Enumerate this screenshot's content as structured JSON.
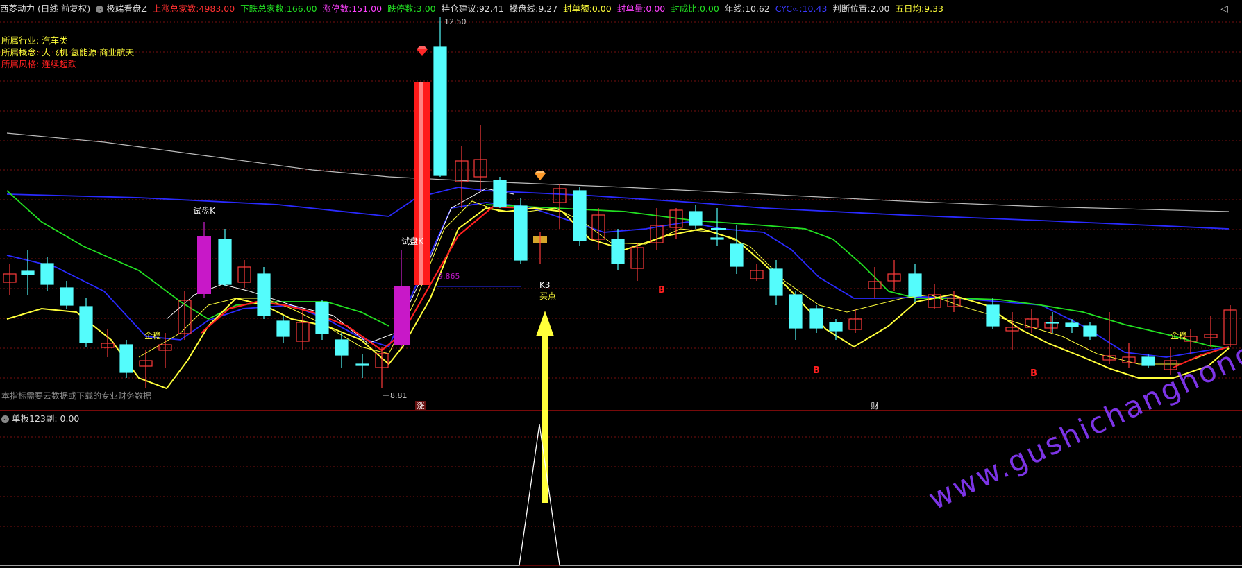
{
  "header": {
    "title": "西菱动力 (日线 前复权)",
    "indicator_name": "极端看盘Z",
    "up_total_label": "上涨总家数:",
    "up_total_value": "4983.00",
    "down_total_label": "下跌总家数:",
    "down_total_value": "166.00",
    "limit_up_label": "涨停数:",
    "limit_up_value": "151.00",
    "limit_down_label": "跌停数:",
    "limit_down_value": "3.00",
    "position_label": "持仓建议:",
    "position_value": "92.41",
    "operate_label": "操盘线:",
    "operate_value": "9.27",
    "seal_amount_label": "封单额:",
    "seal_amount_value": "0.00",
    "seal_volume_label": "封单量:",
    "seal_volume_value": "0.00",
    "seal_ratio_label": "封成比:",
    "seal_ratio_value": "0.00",
    "year_line_label": "年线:",
    "year_line_value": "10.62",
    "cyc_label": "CYC∞:",
    "cyc_value": "10.43",
    "judge_label": "判断位置:",
    "judge_value": "2.00",
    "five_day_label": "五日均:",
    "five_day_value": "9.33",
    "close_icon": "chevron-left-icon"
  },
  "info": {
    "industry_label": "所属行业:",
    "industry_value": "汽车类",
    "concept_label": "所属概念:",
    "concept_value": "大飞机 氢能源 商业航天",
    "style_label": "所属风格:",
    "style_value": "连续超跌"
  },
  "annotations": {
    "high_price": "12.50",
    "low_price": "8.81",
    "level_price": "9.865",
    "trial_k_1": "试盘K",
    "trial_k_2": "试盘K",
    "stabilize_1": "企稳",
    "stabilize_2": "企稳",
    "k3": "K3",
    "buy_point": "买点",
    "b_marker": "B",
    "zhang_marker": "涨",
    "cai_marker": "财"
  },
  "note": "本指标需要云数据或下载的专业财务数据",
  "sub_panel": {
    "title": "单板123副",
    "value": ": 0.00"
  },
  "watermark": "www.gushichanghong.com",
  "colors": {
    "background": "#000000",
    "up_candle": "#ff3b3b",
    "down_candle": "#54fcfc",
    "ma_yellow": "#ffff3a",
    "ma_white": "#ffffff",
    "ma_red": "#ff2020",
    "ma_blue": "#2a2aff",
    "ma_green": "#22e022",
    "ma_gray": "#bdbdbd",
    "magenta": "#d020d0"
  }
}
